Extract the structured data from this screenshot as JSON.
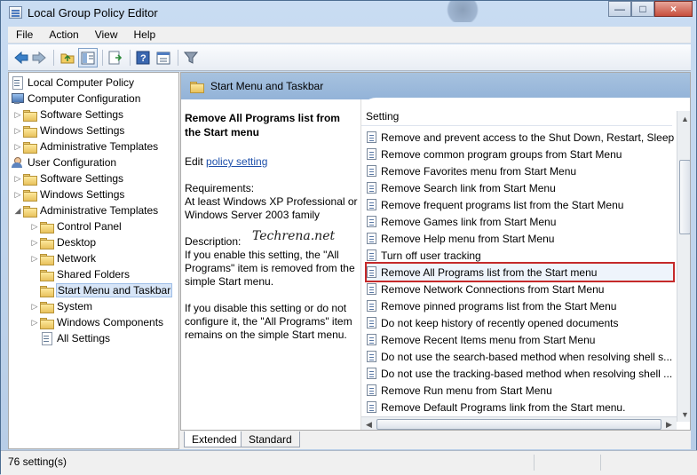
{
  "window": {
    "title": "Local Group Policy Editor"
  },
  "menubar": [
    "File",
    "Action",
    "View",
    "Help"
  ],
  "tree": [
    {
      "label": "Local Computer Policy",
      "level": 0,
      "icon": "doc-tree-icon"
    },
    {
      "label": "Computer Configuration",
      "level": 0,
      "icon": "computer-icon"
    },
    {
      "label": "Software Settings",
      "level": 1,
      "icon": "folder-icon",
      "arrow": "▷"
    },
    {
      "label": "Windows Settings",
      "level": 1,
      "icon": "folder-icon",
      "arrow": "▷"
    },
    {
      "label": "Administrative Templates",
      "level": 1,
      "icon": "folder-icon",
      "arrow": "▷"
    },
    {
      "label": "User Configuration",
      "level": 0,
      "icon": "user-icon"
    },
    {
      "label": "Software Settings",
      "level": 1,
      "icon": "folder-icon",
      "arrow": "▷"
    },
    {
      "label": "Windows Settings",
      "level": 1,
      "icon": "folder-icon",
      "arrow": "▷"
    },
    {
      "label": "Administrative Templates",
      "level": 1,
      "icon": "folder-icon",
      "arrow": "◢"
    },
    {
      "label": "Control Panel",
      "level": 2,
      "icon": "folder-icon",
      "arrow": "▷"
    },
    {
      "label": "Desktop",
      "level": 2,
      "icon": "folder-icon",
      "arrow": "▷"
    },
    {
      "label": "Network",
      "level": 2,
      "icon": "folder-icon",
      "arrow": "▷"
    },
    {
      "label": "Shared Folders",
      "level": 2,
      "icon": "folder-icon"
    },
    {
      "label": "Start Menu and Taskbar",
      "level": 2,
      "icon": "folder-icon",
      "selected": true
    },
    {
      "label": "System",
      "level": 2,
      "icon": "folder-icon",
      "arrow": "▷"
    },
    {
      "label": "Windows Components",
      "level": 2,
      "icon": "folder-icon",
      "arrow": "▷"
    },
    {
      "label": "All Settings",
      "level": 2,
      "icon": "doc-tree-icon"
    }
  ],
  "header": {
    "title": "Start Menu and Taskbar"
  },
  "extended": {
    "title": "Remove All Programs list from the Start menu",
    "edit_prefix": "Edit",
    "edit_link": "policy setting",
    "requirements_label": "Requirements:",
    "requirements_text": "At least Windows XP Professional or Windows Server 2003 family",
    "description_label": "Description:",
    "description_para1": "If you enable this setting, the \"All Programs\" item is removed from the simple Start menu.",
    "description_para2": "If you disable this setting or do not configure it, the \"All Programs\" item remains on the simple Start menu."
  },
  "watermark": "Techrena.net",
  "settings": {
    "column": "Setting",
    "items": [
      "Remove and prevent access to the Shut Down, Restart, Sleep...",
      "Remove common program groups from Start Menu",
      "Remove Favorites menu from Start Menu",
      "Remove Search link from Start Menu",
      "Remove frequent programs list from the Start Menu",
      "Remove Games link from Start Menu",
      "Remove Help menu from Start Menu",
      "Turn off user tracking",
      "Remove All Programs list from the Start menu",
      "Remove Network Connections from Start Menu",
      "Remove pinned programs list from the Start Menu",
      "Do not keep history of recently opened documents",
      "Remove Recent Items menu from Start Menu",
      "Do not use the search-based method when resolving shell s...",
      "Do not use the tracking-based method when resolving shell ...",
      "Remove Run menu from Start Menu",
      "Remove Default Programs link from the Start menu."
    ],
    "highlighted_index": 8
  },
  "tabs": [
    "Extended",
    "Standard"
  ],
  "status": {
    "text": "76 setting(s)"
  },
  "colors": {
    "accent": "#93b3d8",
    "highlight": "#c52a2a",
    "link": "#1d4faa"
  },
  "icons": [
    "back-icon",
    "forward-icon",
    "folder-up-icon",
    "show-hide-tree-icon",
    "export-list-icon",
    "help-icon",
    "properties-icon",
    "filter-icon"
  ]
}
